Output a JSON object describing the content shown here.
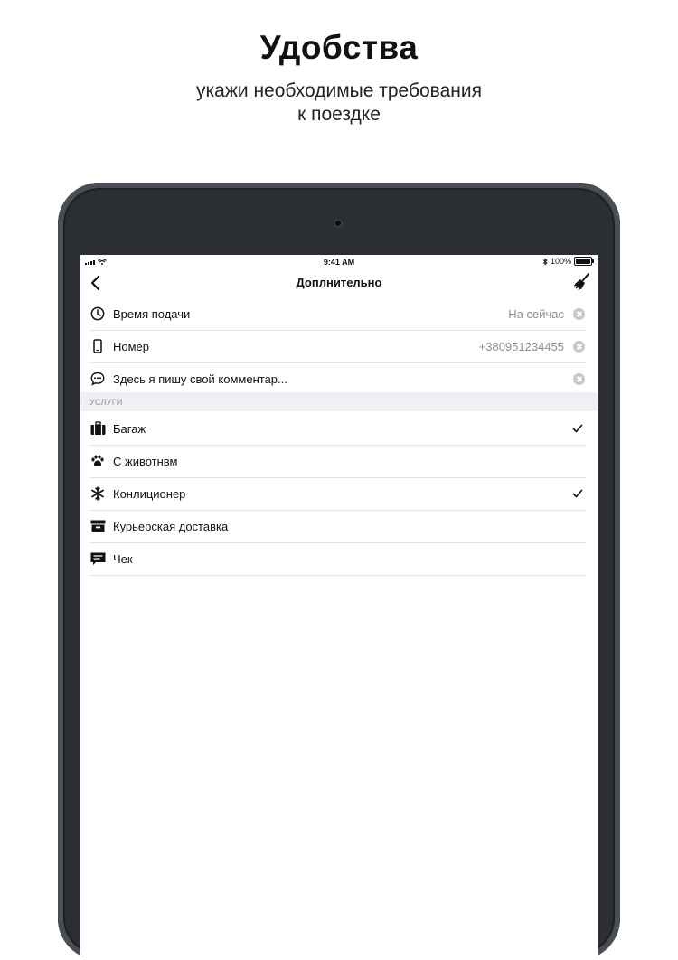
{
  "promo": {
    "title": "Удобства",
    "subtitle_line1": "укажи необходимые требования",
    "subtitle_line2": "к поездке"
  },
  "status_bar": {
    "time": "9:41 AM",
    "battery": "100%"
  },
  "navbar": {
    "title": "Доплнительно",
    "back_icon": "chevron-left-icon",
    "clear_icon": "broom-icon"
  },
  "fields": [
    {
      "icon": "clock-icon",
      "label": "Время подачи",
      "value": "На сейчас"
    },
    {
      "icon": "phone-icon",
      "label": "Номер",
      "value": "+380951234455"
    },
    {
      "icon": "comment-icon",
      "label": "Здесь я пишу свой комментар...",
      "value": ""
    }
  ],
  "services": {
    "header": "УСЛУГИ",
    "items": [
      {
        "icon": "luggage-icon",
        "label": "Багаж",
        "checked": true
      },
      {
        "icon": "paw-icon",
        "label": "С животнвм",
        "checked": false
      },
      {
        "icon": "snowflake-icon",
        "label": "Конлиционер",
        "checked": true
      },
      {
        "icon": "box-icon",
        "label": "Курьерская доставка",
        "checked": false
      },
      {
        "icon": "receipt-icon",
        "label": "Чек",
        "checked": false
      }
    ]
  },
  "colors": {
    "text": "#111111",
    "secondary": "#8e8e93",
    "separator": "#e3e3e6",
    "section_bg": "#efeff4",
    "bezel": "#2b2e32"
  }
}
